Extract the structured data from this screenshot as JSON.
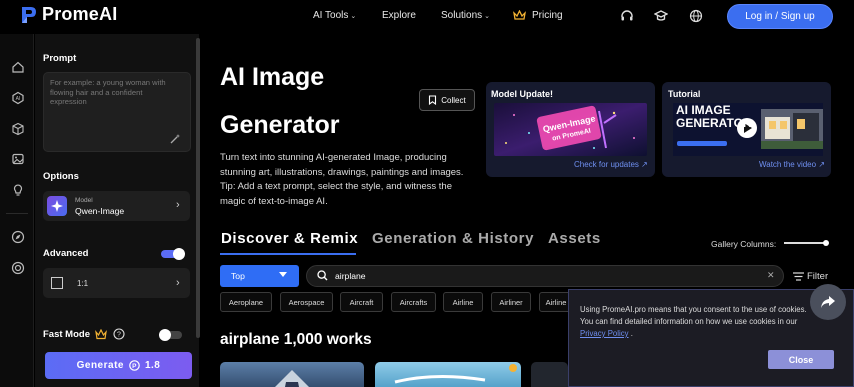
{
  "brand": {
    "name": "PromeAI",
    "accent": "#3b6ef0"
  },
  "nav": {
    "items": [
      {
        "label": "AI Tools",
        "has_dropdown": true
      },
      {
        "label": "Explore",
        "has_dropdown": false
      },
      {
        "label": "Solutions",
        "has_dropdown": true
      },
      {
        "label": "Pricing",
        "has_dropdown": false,
        "icon": "crown-icon"
      }
    ],
    "icons": [
      "headset-icon",
      "graduation-cap-icon",
      "globe-icon"
    ],
    "login_label": "Log in / Sign up"
  },
  "rail": {
    "icons": [
      "home-icon",
      "ai-chip-icon",
      "cube-icon",
      "gallery-icon",
      "lightbulb-icon",
      "compass-icon",
      "target-icon"
    ]
  },
  "panel": {
    "prompt_title": "Prompt",
    "prompt_placeholder": "For example: a young woman with flowing hair and a confident expression",
    "options_title": "Options",
    "model_small": "Model",
    "model_name": "Qwen-Image",
    "advanced_title": "Advanced",
    "advanced_enabled": true,
    "ratio_label": "1:1",
    "fast_mode_label": "Fast Mode",
    "fast_mode_enabled": false,
    "generate_label": "Generate",
    "generate_cost": "1.8"
  },
  "main": {
    "title_line1": "AI Image",
    "title_line2": "Generator",
    "description": "Turn text into stunning AI-generated Image, producing stunning art, illustrations, drawings, paintings and images. Tip: Add a text prompt, select the style, and witness the magic of text-to-image AI.",
    "collect_label": "Collect",
    "model_update_card": {
      "title": "Model Update!",
      "image_text": "Qwen-Image on PromeAI",
      "link": "Check for updates"
    },
    "tutorial_card": {
      "title": "Tutorial",
      "image_text_line1": "AI IMAGE",
      "image_text_line2": "GENERATOR",
      "link": "Watch the video"
    },
    "tabs": [
      {
        "label": "Discover & Remix",
        "active": true
      },
      {
        "label": "Generation & History",
        "active": false
      },
      {
        "label": "Assets",
        "active": false
      }
    ],
    "gallery_columns_label": "Gallery Columns:",
    "sort_select": "Top",
    "search_value": "airplane",
    "filter_label": "Filter",
    "chips": [
      "Aeroplane",
      "Aerospace",
      "Aircraft",
      "Aircrafts",
      "Airline",
      "Airliner",
      "Airline"
    ],
    "works_heading": "airplane 1,000 works"
  },
  "cookie": {
    "text_before": "Using PromeAI.pro means that you consent to the use of cookies. You can find detailed information on how we use cookies in our ",
    "link": "Privacy Policy",
    "text_after": " .",
    "close_label": "Close"
  }
}
